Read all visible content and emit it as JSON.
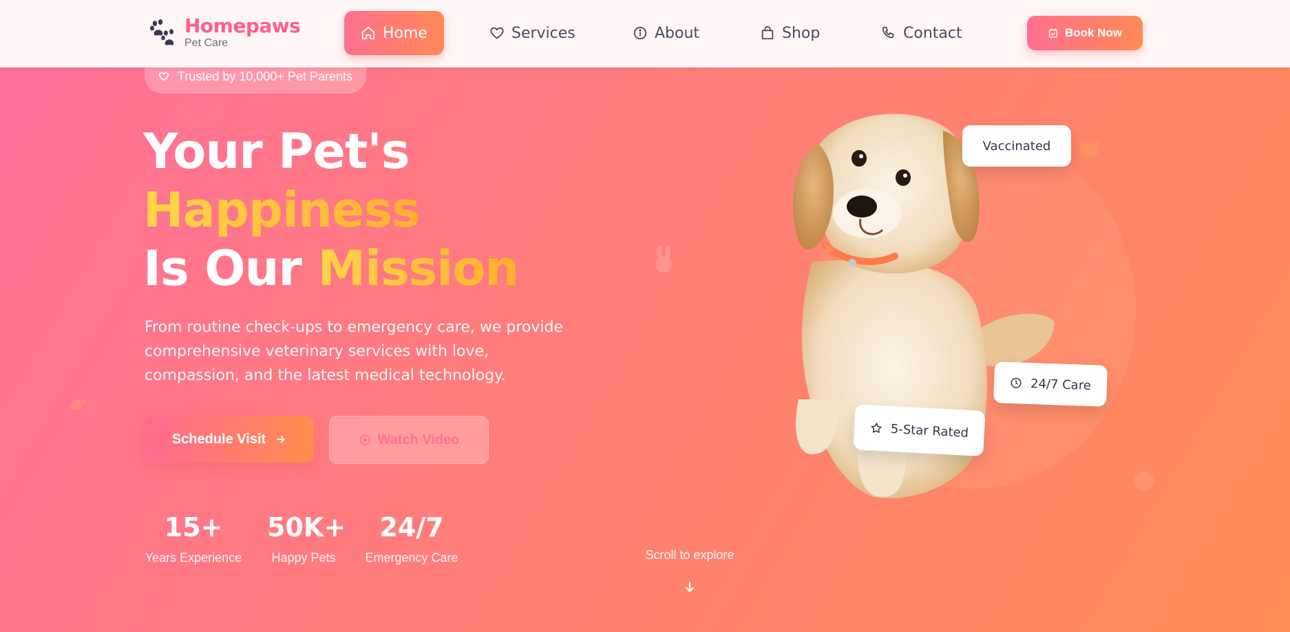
{
  "nav": {
    "brand_name": "Homepaws",
    "brand_sub": "Pet Care",
    "items": [
      {
        "label": "Home",
        "icon": "home-icon",
        "active": true
      },
      {
        "label": "Services",
        "icon": "heart-icon"
      },
      {
        "label": "About",
        "icon": "info-icon"
      },
      {
        "label": "Shop",
        "icon": "shopping-bag-icon"
      },
      {
        "label": "Contact",
        "icon": "phone-icon"
      }
    ],
    "cta": {
      "label": "Book Now",
      "icon": "calendar-check-icon"
    }
  },
  "hero": {
    "badge": "Trusted by 10,000+ Pet Parents",
    "title_line1": "Your Pet's",
    "title_line2": "Happiness",
    "title_line3_a": "Is Our ",
    "title_line3_b": "Mission",
    "description": "From routine check-ups to emergency care, we provide comprehensive veterinary services with love, compassion, and the latest medical technology.",
    "primary_button": "Schedule Visit",
    "secondary_button": "Watch Video",
    "stats": [
      {
        "value": "15+",
        "label": "Years Experience"
      },
      {
        "value": "50K+",
        "label": "Happy Pets"
      },
      {
        "value": "24/7",
        "label": "Emergency Care"
      }
    ],
    "scroll_hint": "Scroll to explore",
    "tags": {
      "vaccinated": "Vaccinated",
      "care": "24/7 Care",
      "rated": "5-Star Rated"
    }
  },
  "colors": {
    "brand": "#ff5f8c",
    "accent_gradient_start": "#ff6f8e",
    "accent_gradient_end": "#ff8a55",
    "highlight_gold": "#ffc83c",
    "text_dark": "#34344a"
  }
}
